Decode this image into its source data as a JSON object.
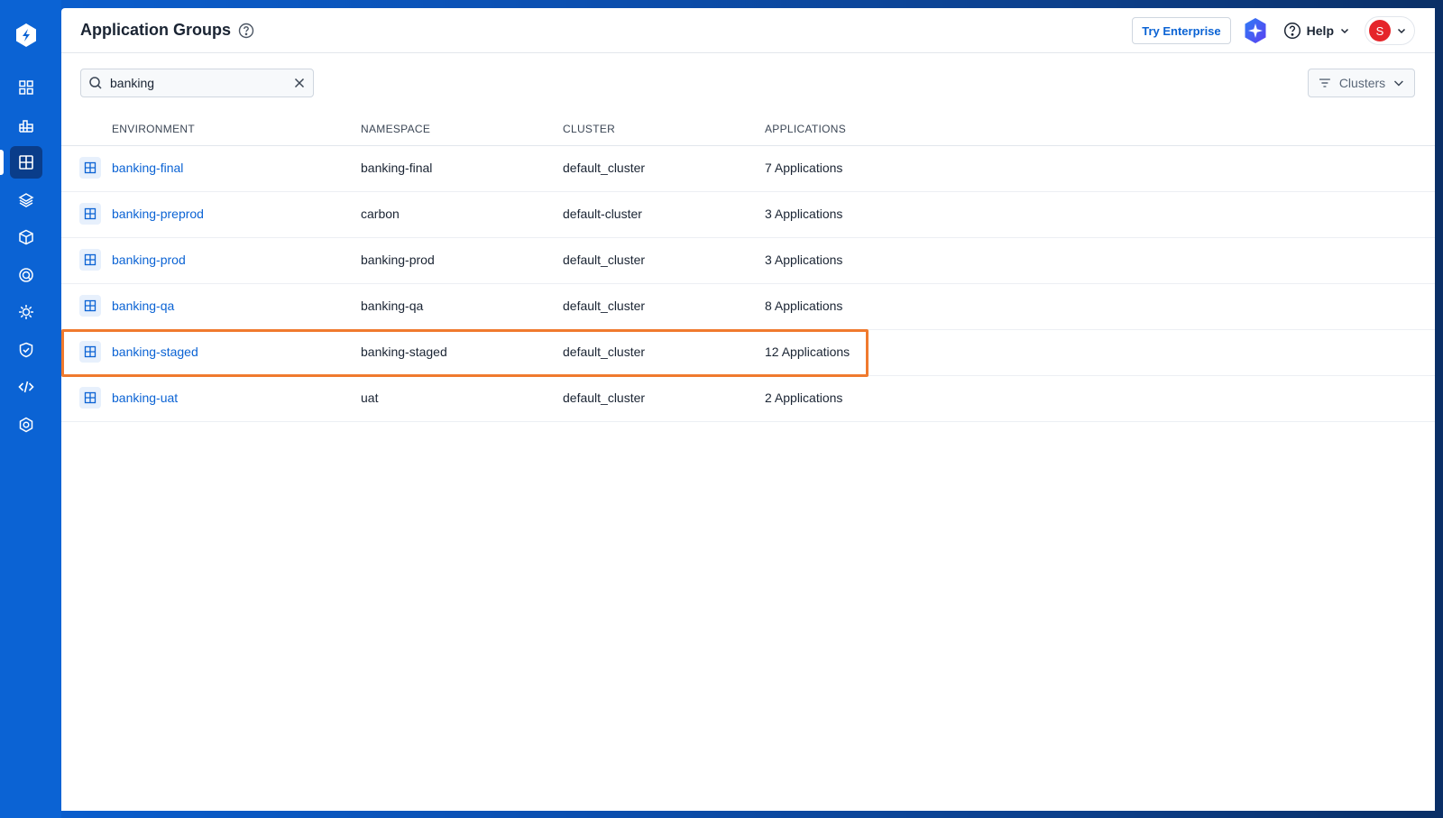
{
  "header": {
    "title": "Application Groups",
    "try_enterprise": "Try Enterprise",
    "help": "Help",
    "avatar_initial": "S"
  },
  "search": {
    "value": "banking"
  },
  "filters": {
    "clusters_label": "Clusters"
  },
  "table": {
    "columns": [
      "ENVIRONMENT",
      "NAMESPACE",
      "CLUSTER",
      "APPLICATIONS"
    ],
    "rows": [
      {
        "environment": "banking-final",
        "namespace": "banking-final",
        "cluster": "default_cluster",
        "applications": "7 Applications"
      },
      {
        "environment": "banking-preprod",
        "namespace": "carbon",
        "cluster": "default-cluster",
        "applications": "3 Applications"
      },
      {
        "environment": "banking-prod",
        "namespace": "banking-prod",
        "cluster": "default_cluster",
        "applications": "3 Applications"
      },
      {
        "environment": "banking-qa",
        "namespace": "banking-qa",
        "cluster": "default_cluster",
        "applications": "8 Applications"
      },
      {
        "environment": "banking-staged",
        "namespace": "banking-staged",
        "cluster": "default_cluster",
        "applications": "12 Applications"
      },
      {
        "environment": "banking-uat",
        "namespace": "uat",
        "cluster": "default_cluster",
        "applications": "2 Applications"
      }
    ]
  },
  "sidebar": {
    "items": [
      "overview-icon",
      "chart-icon",
      "application-groups-icon",
      "layers-icon",
      "package-icon",
      "security-scan-icon",
      "cluster-icon",
      "shield-icon",
      "code-icon",
      "settings-icon"
    ]
  },
  "colors": {
    "sidebar": "#0b63d4",
    "accent": "#0b63d4",
    "highlight": "#f07a2e",
    "avatar": "#e5252a"
  }
}
